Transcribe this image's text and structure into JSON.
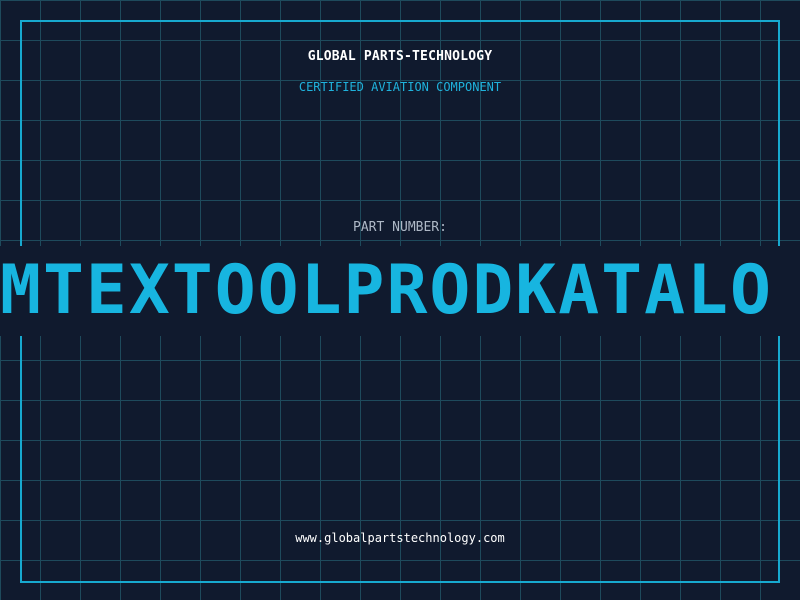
{
  "brand": {
    "name": "GLOBAL PARTS-TECHNOLOGY",
    "tagline": "CERTIFIED AVIATION COMPONENT"
  },
  "part": {
    "label": "PART NUMBER:",
    "number": "MTEXTOOLPRODKATALO"
  },
  "footer": {
    "url": "www.globalpartstechnology.com"
  },
  "colors": {
    "background": "#101a2e",
    "grid": "#1e4a5c",
    "accent": "#17b5e0",
    "text": "#ffffff",
    "label": "#aeb8c6"
  }
}
